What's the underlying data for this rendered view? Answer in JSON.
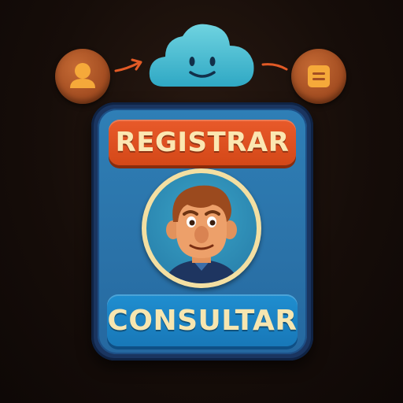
{
  "flow": {
    "user_icon": "user-icon",
    "cloud_icon": "smiling-cloud-icon",
    "document_icon": "document-icon"
  },
  "card": {
    "register_label": "REGISTRAR",
    "consult_label": "CONSULTAR"
  },
  "colors": {
    "background": "#160d09",
    "register": "#e05020",
    "consult": "#1a86c8",
    "card_frame": "#1a3560",
    "cloud": "#4cc0d4",
    "icon_circle": "#a44e22"
  }
}
